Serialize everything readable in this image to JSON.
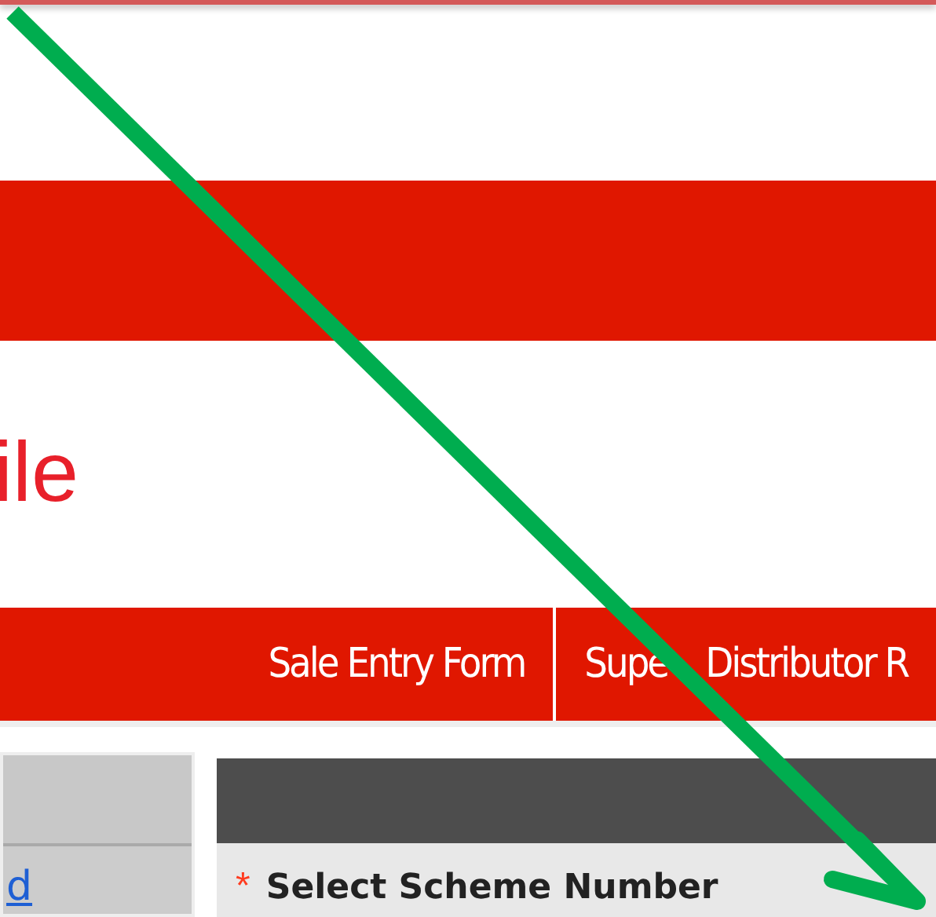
{
  "page_title": "ile",
  "nav": [
    {
      "label": "Sale Entry Form"
    },
    {
      "label_parts": [
        "Supe",
        "Distributor R"
      ]
    }
  ],
  "sidebar": {
    "link": "d"
  },
  "form": {
    "required_mark": "*",
    "field_label": "Select Scheme Number"
  },
  "annotation": {
    "kind": "arrow",
    "color": "#00ad4f"
  }
}
